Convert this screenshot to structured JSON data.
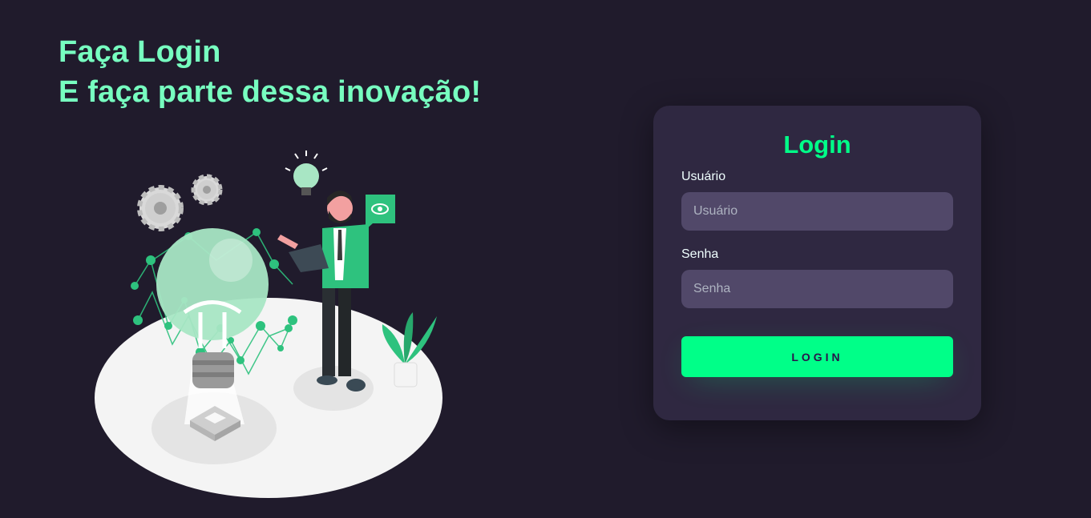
{
  "headline": {
    "line1": "Faça Login",
    "line2": "E faça parte dessa inovação!"
  },
  "illustration": {
    "icons": [
      "gear-icon",
      "lightbulb-icon",
      "eye-icon",
      "plant-icon"
    ]
  },
  "login_card": {
    "title": "Login",
    "username": {
      "label": "Usuário",
      "placeholder": "Usuário",
      "value": ""
    },
    "password": {
      "label": "Senha",
      "placeholder": "Senha",
      "value": ""
    },
    "submit_label": "LOGIN"
  },
  "colors": {
    "background": "#201b2c",
    "card": "#2f2841",
    "input": "#514869",
    "accent": "#00ff88",
    "headline": "#77ffc0"
  }
}
